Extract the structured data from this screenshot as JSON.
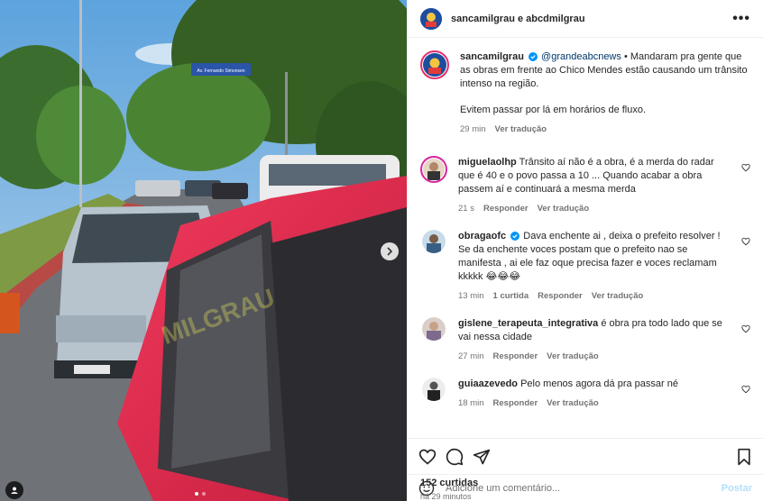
{
  "post": {
    "header_names": "sancamilgrau e abcdmilgrau",
    "more_label": "•••",
    "caption": {
      "username": "sancamilgrau",
      "mention": "@grandeabcnews",
      "text": " • Mandaram pra gente que as obras em frente ao Chico Mendes estão causando um trânsito intenso na região.",
      "text2": "Evitem passar por lá em horários de fluxo.",
      "time": "29 min",
      "translate": "Ver tradução"
    },
    "comments": [
      {
        "username": "miguelaolhp",
        "text": " Trânsito aí não é a obra, é a merda do radar que é 40 e o povo passa a 10 ... Quando acabar a obra passem aí e continuará a mesma merda",
        "time": "21 s",
        "reply": "Responder",
        "translate": "Ver tradução"
      },
      {
        "username": "obragaofc",
        "text": " Dava enchente ai , deixa o prefeito resolver ! Se da enchente voces postam que o prefeito nao se manifesta , ai ele faz oque precisa fazer e voces reclamam kkkkk 😂😂😂",
        "time": "13 min",
        "likes": "1 curtida",
        "reply": "Responder",
        "translate": "Ver tradução"
      },
      {
        "username": "gislene_terapeuta_integrativa",
        "text": " é obra pra todo lado que se vai nessa cidade",
        "time": "27 min",
        "reply": "Responder",
        "translate": "Ver tradução"
      },
      {
        "username": "guiaazevedo",
        "text": " Pelo menos agora dá pra passar né",
        "time": "18 min",
        "reply": "Responder",
        "translate": "Ver tradução"
      }
    ],
    "likes_count": "152 curtidas",
    "time_ago": "há 29 minutos",
    "comment_placeholder": "Adicione um comentário...",
    "post_button": "Postar",
    "photo": {
      "street_sign": "Av. Fernando Simonsen",
      "watermark": "MILGRAU",
      "slide_count": 2,
      "active_slide": 1
    },
    "colors": {
      "verified": "#0095f6",
      "link": "#00376b",
      "post_button": "#b2dffc"
    }
  }
}
